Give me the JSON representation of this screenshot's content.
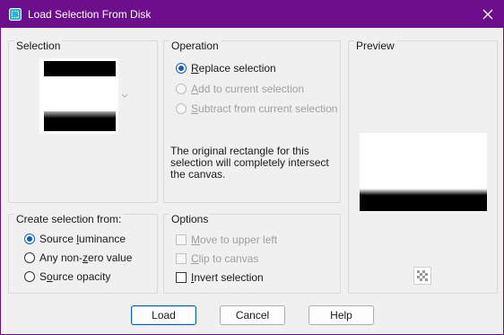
{
  "window": {
    "title": "Load Selection From Disk"
  },
  "selection_group": {
    "title": "Selection"
  },
  "operation_group": {
    "title": "Operation",
    "options": [
      {
        "pre": "",
        "key": "R",
        "post": "eplace selection",
        "checked": true,
        "enabled": true
      },
      {
        "pre": "",
        "key": "A",
        "post": "dd to current selection",
        "checked": false,
        "enabled": false
      },
      {
        "pre": "",
        "key": "S",
        "post": "ubtract from current selection",
        "checked": false,
        "enabled": false
      }
    ],
    "info_text": "The original rectangle for this selection will completely intersect the canvas."
  },
  "preview_group": {
    "title": "Preview"
  },
  "create_group": {
    "title": "Create selection from:",
    "options": [
      {
        "pre": "Source ",
        "key": "l",
        "post": "uminance",
        "checked": true
      },
      {
        "pre": "Any non-",
        "key": "z",
        "post": "ero value",
        "checked": false
      },
      {
        "pre": "S",
        "key": "o",
        "post": "urce opacity",
        "checked": false
      }
    ]
  },
  "options_group": {
    "title": "Options",
    "checks": [
      {
        "pre": "",
        "key": "M",
        "post": "ove to upper left",
        "checked": false,
        "enabled": false
      },
      {
        "pre": "",
        "key": "C",
        "post": "lip to canvas",
        "checked": false,
        "enabled": false
      },
      {
        "pre": "",
        "key": "I",
        "post": "nvert selection",
        "checked": false,
        "enabled": true
      }
    ]
  },
  "buttons": {
    "load": "Load",
    "cancel": "Cancel",
    "help": "Help"
  },
  "colors": {
    "titlebar": "#6d0f8c",
    "accent": "#0a5fbd"
  },
  "icons": {
    "app": "selection-file-icon",
    "close": "close-icon",
    "preview_toggle": "checkerboard-icon",
    "thumbnail_dropdown": "chevron-down-icon"
  }
}
